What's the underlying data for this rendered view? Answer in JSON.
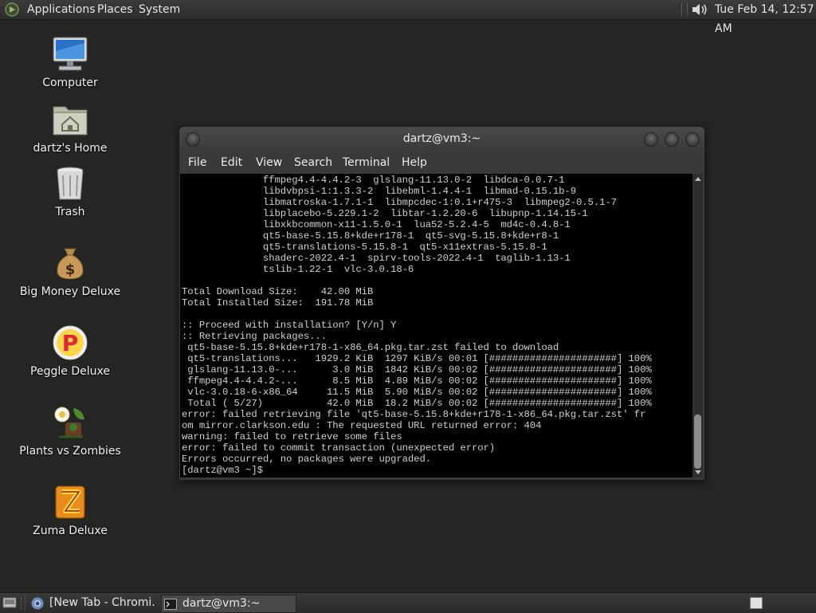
{
  "top_panel": {
    "applications": "Applications",
    "places": "Places",
    "system": "System",
    "clock": "Tue Feb 14, 12:57 AM"
  },
  "desktop_icons": [
    {
      "label": "Computer",
      "icon": "computer-icon"
    },
    {
      "label": "dartz's Home",
      "icon": "home-folder-icon"
    },
    {
      "label": "Trash",
      "icon": "trash-icon"
    },
    {
      "label": "Big Money Deluxe",
      "icon": "money-bag-icon"
    },
    {
      "label": "Peggle Deluxe",
      "icon": "peggle-icon"
    },
    {
      "label": "Plants vs Zombies",
      "icon": "plants-vs-zombies-icon"
    },
    {
      "label": "Zuma Deluxe",
      "icon": "zuma-icon"
    }
  ],
  "terminal": {
    "title": "dartz@vm3:~",
    "menu": {
      "file": "File",
      "edit": "Edit",
      "view": "View",
      "search": "Search",
      "terminal": "Terminal",
      "help": "Help"
    },
    "output": "              ffmpeg4.4-4.4.2-3  glslang-11.13.0-2  libdca-0.0.7-1\n              libdvbpsi-1:1.3.3-2  libebml-1.4.4-1  libmad-0.15.1b-9\n              libmatroska-1.7.1-1  libmpcdec-1:0.1+r475-3  libmpeg2-0.5.1-7\n              libplacebo-5.229.1-2  libtar-1.2.20-6  libupnp-1.14.15-1\n              libxkbcommon-x11-1.5.0-1  lua52-5.2.4-5  md4c-0.4.8-1\n              qt5-base-5.15.8+kde+r178-1  qt5-svg-5.15.8+kde+r8-1\n              qt5-translations-5.15.8-1  qt5-x11extras-5.15.8-1\n              shaderc-2022.4-1  spirv-tools-2022.4-1  taglib-1.13-1\n              tslib-1.22-1  vlc-3.0.18-6\n\nTotal Download Size:    42.00 MiB\nTotal Installed Size:  191.78 MiB\n\n:: Proceed with installation? [Y/n] Y\n:: Retrieving packages...\n qt5-base-5.15.8+kde+r178-1-x86_64.pkg.tar.zst failed to download\n qt5-translations...   1929.2 KiB  1297 KiB/s 00:01 [######################] 100%\n glslang-11.13.0-...      3.0 MiB  1842 KiB/s 00:02 [######################] 100%\n ffmpeg4.4-4.4.2-...      8.5 MiB  4.89 MiB/s 00:02 [######################] 100%\n vlc-3.0.18-6-x86_64     11.5 MiB  5.90 MiB/s 00:02 [######################] 100%\n Total ( 5/27)           42.0 MiB  18.2 MiB/s 00:02 [######################] 100%\nerror: failed retrieving file 'qt5-base-5.15.8+kde+r178-1-x86_64.pkg.tar.zst' fr\nom mirror.clarkson.edu : The requested URL returned error: 404\nwarning: failed to retrieve some files\nerror: failed to commit transaction (unexpected error)\nErrors occurred, no packages were upgraded.\n[dartz@vm3 ~]$ "
  },
  "taskbar": {
    "chromium": "[New Tab - Chromi...",
    "terminal": "dartz@vm3:~"
  },
  "colors": {
    "desktop_bg": "#252623",
    "panel_bg": "#333331",
    "terminal_bg": "#000000",
    "terminal_fg": "#cfcfcf"
  }
}
